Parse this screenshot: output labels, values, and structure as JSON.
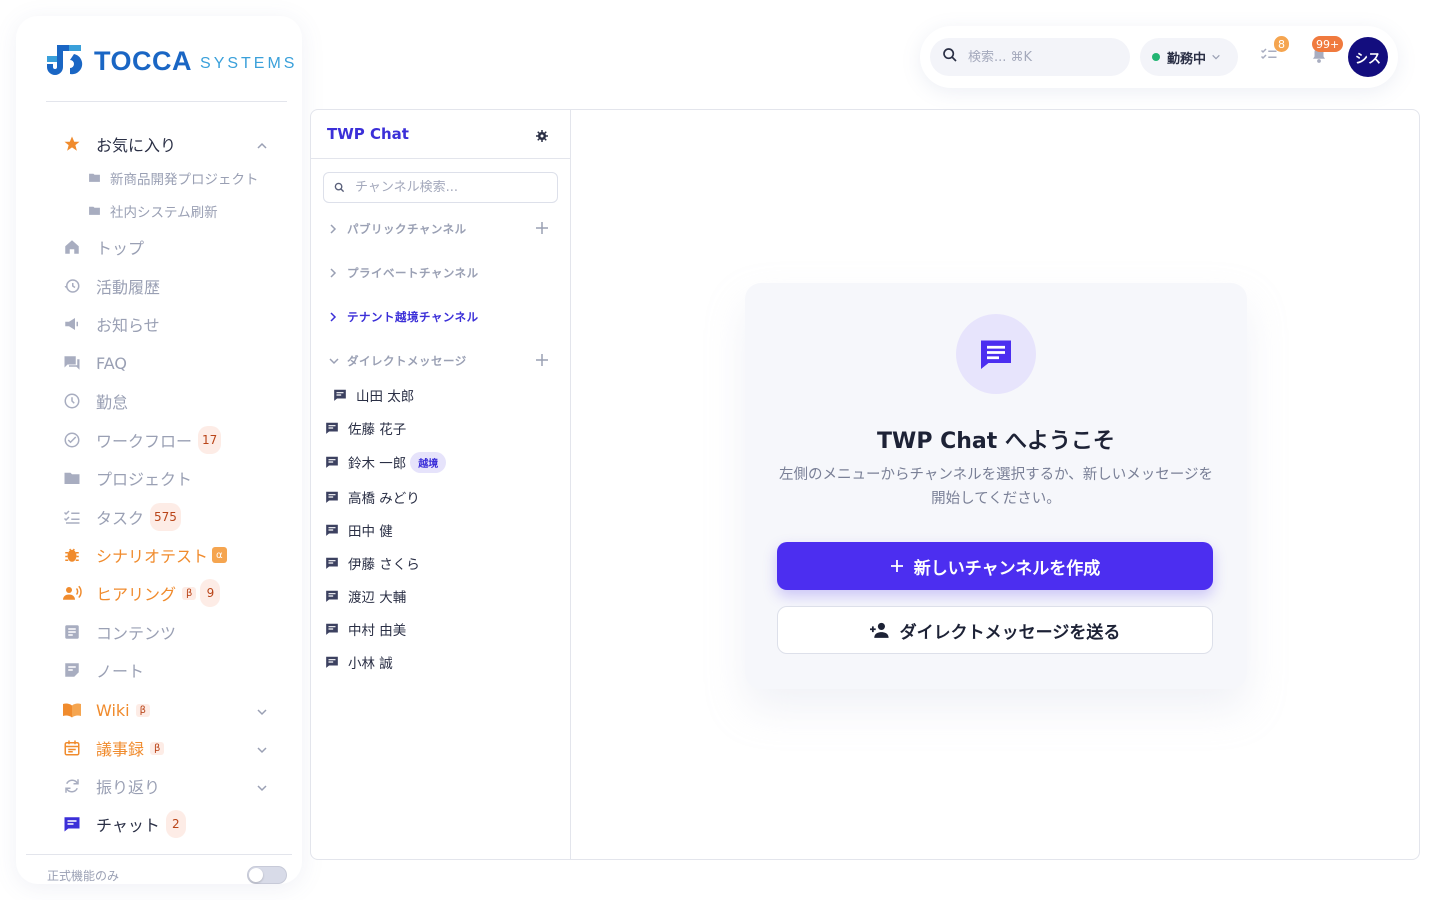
{
  "brand": {
    "name": "TOCCA",
    "sub": "SYSTEMS"
  },
  "colors": {
    "accent": "#4c2ef0",
    "orange": "#f08b2d",
    "brand_blue": "#1a66c4",
    "online": "#22b573"
  },
  "sidebar": {
    "favorites": {
      "label": "お気に入り",
      "items": [
        "新商品開発プロジェクト",
        "社内システム刷新"
      ]
    },
    "items": [
      {
        "label": "トップ",
        "icon": "home-icon"
      },
      {
        "label": "活動履歴",
        "icon": "history-icon"
      },
      {
        "label": "お知らせ",
        "icon": "megaphone-icon"
      },
      {
        "label": "FAQ",
        "icon": "faq-icon"
      },
      {
        "label": "勤怠",
        "icon": "clock-icon"
      },
      {
        "label": "ワークフロー",
        "icon": "check-circle-icon",
        "badge": "17"
      },
      {
        "label": "プロジェクト",
        "icon": "folder-icon"
      },
      {
        "label": "タスク",
        "icon": "tasklist-icon",
        "badge": "575"
      },
      {
        "label": "シナリオテスト",
        "icon": "bug-icon",
        "tag": "α"
      },
      {
        "label": "ヒアリング",
        "icon": "interview-icon",
        "tag": "β",
        "badge": "9"
      },
      {
        "label": "コンテンツ",
        "icon": "document-icon"
      },
      {
        "label": "ノート",
        "icon": "note-icon"
      },
      {
        "label": "Wiki",
        "icon": "book-icon",
        "tag": "β"
      },
      {
        "label": "議事録",
        "icon": "calendar-icon",
        "tag": "β"
      },
      {
        "label": "振り返り",
        "icon": "refresh-icon"
      },
      {
        "label": "チャット",
        "icon": "chat-icon",
        "badge": "2"
      }
    ],
    "footer_label": "正式機能のみ"
  },
  "topbar": {
    "search_placeholder": "検索... ⌘K",
    "status": "勤務中",
    "tasks_badge": "8",
    "notifications_badge": "99+",
    "avatar": "シス"
  },
  "chat": {
    "title": "TWP Chat",
    "search_placeholder": "チャンネル検索...",
    "sections": {
      "public": "パブリックチャンネル",
      "private": "プライベートチャンネル",
      "tenant": "テナント越境チャンネル",
      "direct": "ダイレクトメッセージ"
    },
    "dms": [
      {
        "name": "山田 太郎"
      },
      {
        "name": "佐藤 花子"
      },
      {
        "name": "鈴木 一郎",
        "tag": "越境"
      },
      {
        "name": "高橋 みどり"
      },
      {
        "name": "田中 健"
      },
      {
        "name": "伊藤 さくら"
      },
      {
        "name": "渡辺 大輔"
      },
      {
        "name": "中村 由美"
      },
      {
        "name": "小林 誠"
      }
    ],
    "welcome": {
      "title": "TWP Chat へようこそ",
      "desc": "左側のメニューからチャンネルを選択するか、新しいメッセージを開始してください。",
      "primary_button": "新しいチャンネルを作成",
      "secondary_button": "ダイレクトメッセージを送る"
    }
  }
}
